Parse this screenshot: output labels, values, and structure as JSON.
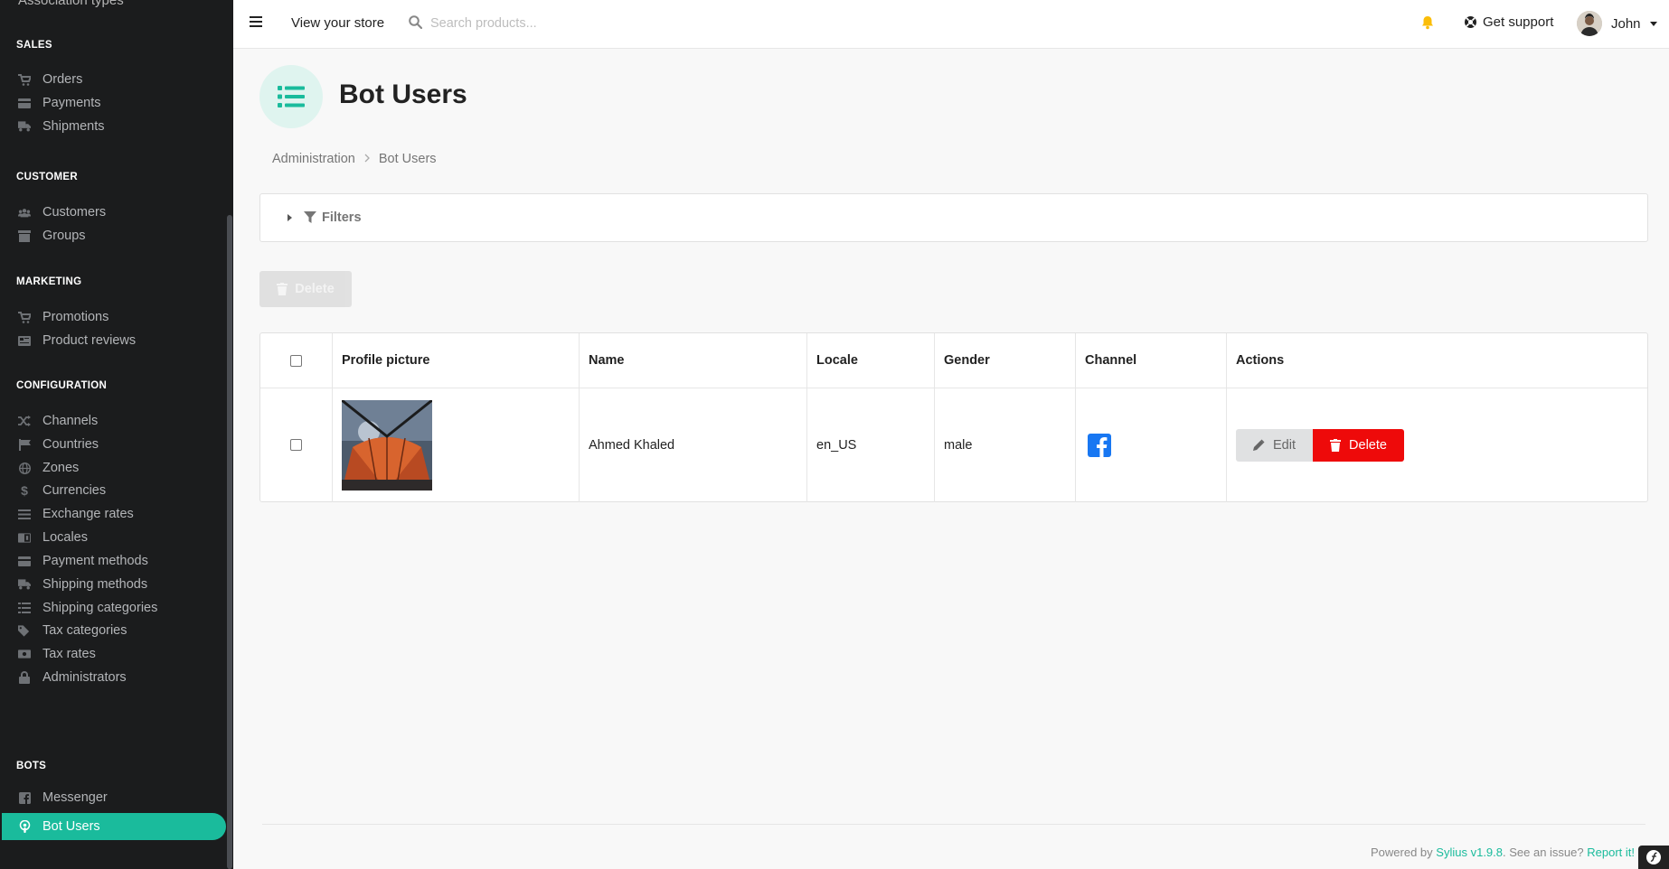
{
  "sidebar": {
    "partial_item": "Association types",
    "sections": [
      {
        "label": "SALES",
        "items": [
          "Orders",
          "Payments",
          "Shipments"
        ]
      },
      {
        "label": "CUSTOMER",
        "items": [
          "Customers",
          "Groups"
        ]
      },
      {
        "label": "MARKETING",
        "items": [
          "Promotions",
          "Product reviews"
        ]
      },
      {
        "label": "CONFIGURATION",
        "items": [
          "Channels",
          "Countries",
          "Zones",
          "Currencies",
          "Exchange rates",
          "Locales",
          "Payment methods",
          "Shipping methods",
          "Shipping categories",
          "Tax categories",
          "Tax rates",
          "Administrators"
        ]
      },
      {
        "label": "BOTS",
        "items": [
          "Messenger",
          "Bot Users"
        ]
      }
    ],
    "active_item": "Bot Users",
    "accent_color": "#1abb9c"
  },
  "topbar": {
    "view_store": "View your store",
    "search_placeholder": "Search products...",
    "get_support": "Get support",
    "user_name": "John"
  },
  "page": {
    "title": "Bot Users",
    "breadcrumb": [
      "Administration",
      "Bot Users"
    ]
  },
  "filters": {
    "label": "Filters"
  },
  "bulk": {
    "delete_label": "Delete"
  },
  "table": {
    "columns": [
      "Profile picture",
      "Name",
      "Locale",
      "Gender",
      "Channel",
      "Actions"
    ],
    "rows": [
      {
        "name": "Ahmed Khaled",
        "locale": "en_US",
        "gender": "male",
        "channel_icon": "facebook-icon",
        "edit_label": "Edit",
        "delete_label": "Delete"
      }
    ]
  },
  "footer": {
    "powered_by": "Powered by",
    "version_link": "Sylius v1.9.8",
    "issue_text": ". See an issue?",
    "report_link": "Report it!"
  }
}
